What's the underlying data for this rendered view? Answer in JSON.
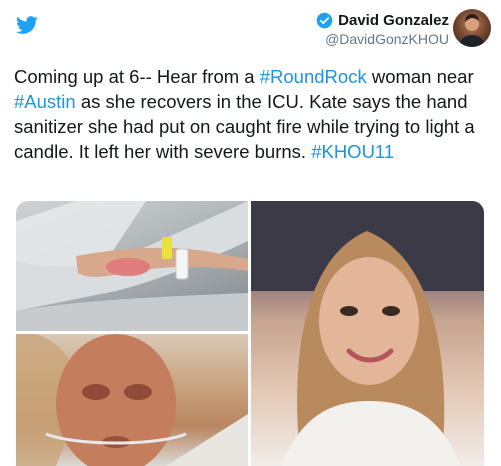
{
  "author": {
    "display_name": "David Gonzalez",
    "handle": "@DavidGonzKHOU",
    "verified": true
  },
  "icons": {
    "platform": "twitter-bird-icon",
    "verified": "verified-badge-icon"
  },
  "colors": {
    "brand": "#1da1f2",
    "hashtag": "#1b95e0",
    "text": "#14171a",
    "muted": "#657786"
  },
  "tweet": {
    "segments": [
      {
        "type": "text",
        "value": "Coming up at 6-- Hear from a "
      },
      {
        "type": "hashtag",
        "value": "#RoundRock"
      },
      {
        "type": "text",
        "value": " woman near "
      },
      {
        "type": "hashtag",
        "value": "#Austin"
      },
      {
        "type": "text",
        "value": " as she recovers in the ICU.  Kate says the hand sanitizer she had put on caught fire while trying to light a candle. It left her with severe burns. "
      },
      {
        "type": "hashtag",
        "value": "#KHOU11"
      }
    ]
  }
}
